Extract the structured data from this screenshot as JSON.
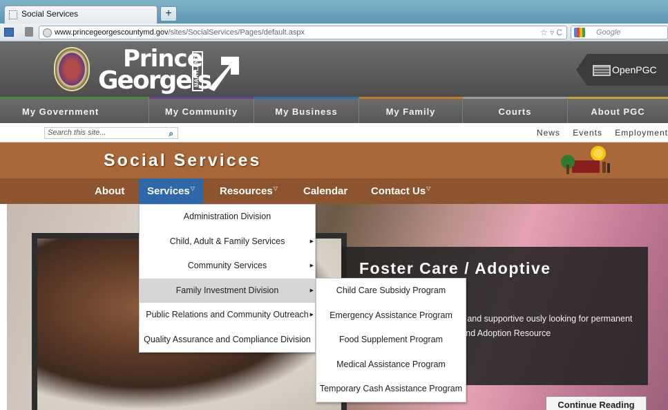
{
  "browser": {
    "tab_title": "Social Services",
    "new_tab": "+",
    "url_domain": "www.princegeorgescountymd.gov",
    "url_path": "/sites/SocialServices/Pages/default.aspx",
    "url_controls": "☆ ▿ C",
    "search_placeholder": "Google"
  },
  "site": {
    "logo_line1": "Prince",
    "logo_line2": "George's",
    "logo_county": "county",
    "logo_state": "MARYLAND",
    "openpgc": "OpenPGC",
    "main_nav": [
      {
        "label": "My Government",
        "color": "#4a8a3c"
      },
      {
        "label": "My Community",
        "color": "#6a3f8c"
      },
      {
        "label": "My Business",
        "color": "#2f6fae"
      },
      {
        "label": "My Family",
        "color": "#c47a25"
      },
      {
        "label": "Courts",
        "color": "#9c9c9c"
      },
      {
        "label": "About PGC",
        "color": "#c6a630"
      }
    ],
    "search_placeholder": "Search this site...",
    "util_links": [
      "News",
      "Events",
      "Employment"
    ]
  },
  "dept": {
    "title": "Social Services",
    "subnav": [
      "About",
      "Services",
      "Resources",
      "Calendar",
      "Contact Us"
    ]
  },
  "services_menu": [
    "Administration Division",
    "Child, Adult & Family Services",
    "Community Services",
    "Family Investment Division",
    "Public Relations and Community Outreach",
    "Quality Assurance and Compliance Division"
  ],
  "fid_submenu": [
    "Child Care Subsidy Program",
    "Emergency Assistance Program",
    "Food Supplement Program",
    "Medical Assistance Program",
    "Temporary Cash Assistance Program"
  ],
  "hero": {
    "title": "Foster Care / Adoptive",
    "body": "foster care that need strong and supportive ously looking for permanent homes for bout our Foster and Adoption Resource",
    "cta": "Continue Reading"
  }
}
